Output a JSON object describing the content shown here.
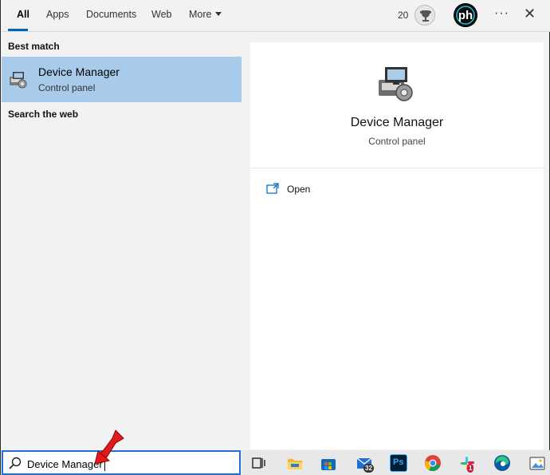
{
  "tabs": [
    {
      "label": "All",
      "active": true
    },
    {
      "label": "Apps"
    },
    {
      "label": "Documents"
    },
    {
      "label": "Web"
    },
    {
      "label": "More"
    }
  ],
  "header": {
    "points": "20",
    "trophy_icon": "trophy-icon",
    "avatar_text": "ph",
    "more_options": "···",
    "close": "✕"
  },
  "left_panel": {
    "best_match_label": "Best match",
    "best_match": {
      "title": "Device Manager",
      "subtitle": "Control panel",
      "icon": "device-manager-icon"
    },
    "search_web_label": "Search the web"
  },
  "right_panel": {
    "title": "Device Manager",
    "subtitle": "Control panel",
    "actions": [
      {
        "label": "Open",
        "icon": "open-window-icon"
      }
    ]
  },
  "search": {
    "value": "Device Manager",
    "icon": "search-icon"
  },
  "taskbar": {
    "items": [
      {
        "name": "task-view-icon"
      },
      {
        "name": "file-explorer-icon"
      },
      {
        "name": "microsoft-store-icon"
      },
      {
        "name": "mail-icon",
        "badge": "32"
      },
      {
        "name": "photoshop-icon",
        "text": "Ps"
      },
      {
        "name": "chrome-icon"
      },
      {
        "name": "slack-icon",
        "badge": "1"
      },
      {
        "name": "edge-icon"
      },
      {
        "name": "photos-icon"
      }
    ]
  },
  "colors": {
    "selection": "#a8cbec",
    "accent": "#0067c0",
    "annotation_arrow": "#e11b1b"
  }
}
